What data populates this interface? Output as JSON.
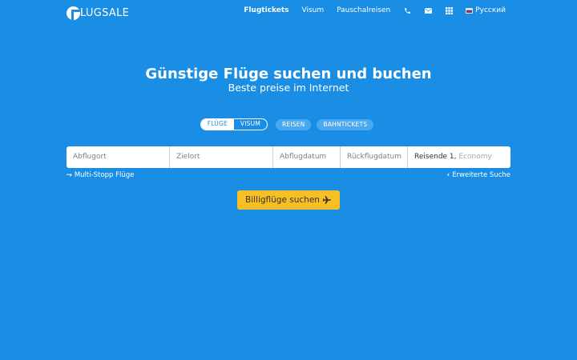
{
  "header": {
    "logo_text": "LUGSALE",
    "nav": {
      "flights": "Flugtickets",
      "visa": "Visum",
      "packages": "Pauschalreisen",
      "language": "Русский"
    },
    "icons": [
      "phone-icon",
      "envelope-icon",
      "grid-icon",
      "flag-ru-icon"
    ]
  },
  "hero": {
    "title": "Günstige Flüge suchen und buchen",
    "subtitle": "Beste preise im Internet"
  },
  "tabs": {
    "flights": "FLÜGE",
    "visa": "VISUM",
    "trips": "REISEN",
    "rail": "BAHNTICKETS"
  },
  "search": {
    "from_placeholder": "Abflugort",
    "to_placeholder": "Zielort",
    "depart_placeholder": "Abflugdatum",
    "return_placeholder": "Rückflugdatum",
    "travelers": "Reisende 1,",
    "cabin": "Economy"
  },
  "links": {
    "multistop": "Multi-Stopp Flüge",
    "advanced": "Erweiterte Suche"
  },
  "cta": {
    "label": "Billigflüge suchen"
  },
  "colors": {
    "background": "#1a8ee4",
    "cta": "#f7bf22"
  }
}
